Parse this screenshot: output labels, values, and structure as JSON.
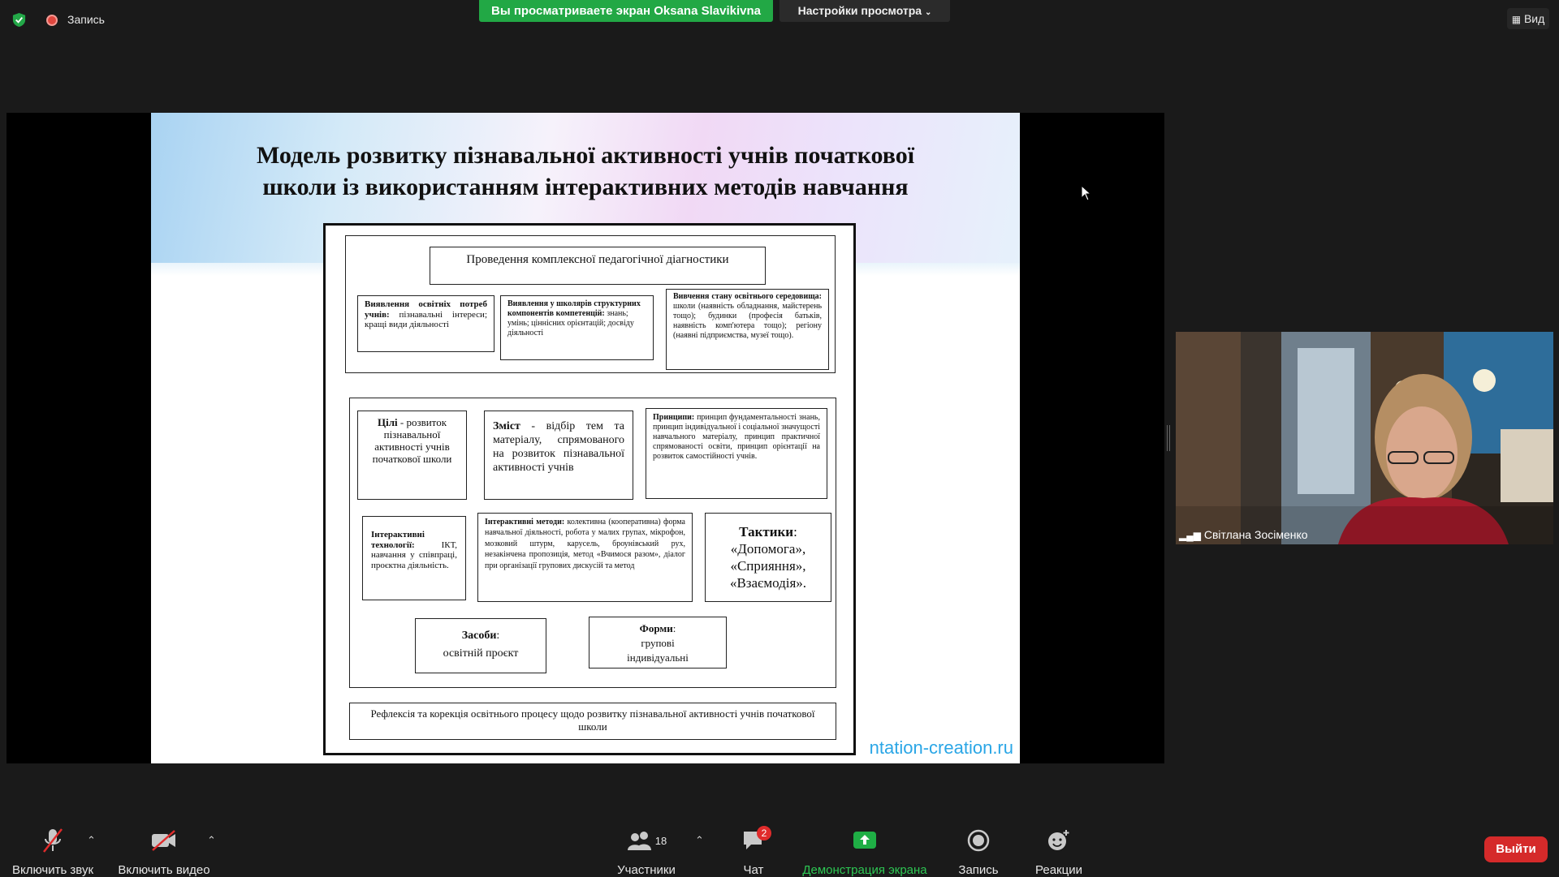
{
  "topbar": {
    "recording_label": "Запись",
    "viewing_banner": "Вы просматриваете экран Oksana Slavikivna",
    "view_settings": "Настройки просмотра",
    "view_button": "Вид"
  },
  "slide": {
    "title_line1": "Модель розвитку пізнавальної активності учнів початкової",
    "title_line2": "школи із використанням інтерактивних методів навчання",
    "site_label": "ntation-creation.ru",
    "diagram": {
      "top_title": "Проведення комплексної педагогічної діагностики",
      "needs_bold": "Виявлення освітніх потреб учнів:",
      "needs_text": "пізнавальні інтереси; кращі види діяльності",
      "components_bold": "Виявлення у школярів структурних компонентів компетенцій:",
      "components_text": "знань; умінь; ціннісних орієнтацій; досвіду діяльності",
      "environment_bold": "Вивчення стану освітнього середовища:",
      "environment_text": "школи (наявність обладнання, майстерень тощо); будинки (професія батьків, наявність комп'ютера тощо); регіону (наявні підприємства, музеї тощо).",
      "goals_bold": "Цілі",
      "goals_text": " - розвиток пізнавальної активності учнів початкової школи",
      "content_bold": "Зміст",
      "content_text": " - відбір тем та матеріалу, спрямованого на розвиток пізнавальної активності учнів",
      "principles_bold": "Принципи:",
      "principles_text": " принцип фундаментальності знань, принцип індивідуальної і соціальної значущості навчального матеріалу, принцип практичної спрямованості освіти, принцип орієнтації на розвиток самостійності учнів.",
      "tech_bold": "Інтерактивні технології:",
      "tech_text": "ІКТ, навчання у співпраці, проєктна діяльність.",
      "methods_bold": "Інтерактивні методи:",
      "methods_text": "колективна (кооперативна) форма навчальної діяльності, робота у малих групах, мікрофон, мозковий штурм, карусель, броунівський рух, незакінчена пропозиція, метод «Вчимося разом», діалог при організації групових дискусій та метод",
      "tactics_bold": "Тактики",
      "tactics_colon": ":",
      "tactic1": "«Допомога»,",
      "tactic2": "«Сприяння»,",
      "tactic3": "«Взаємодія».",
      "means_bold": "Засоби",
      "means_colon": ":",
      "means_text": "освітній проєкт",
      "forms_bold": "Форми",
      "forms_colon": ":",
      "forms_line1": "групові",
      "forms_line2": "індивідуальні",
      "reflection": "Рефлексія та корекція освітнього процесу щодо розвитку пізнавальної активності учнів початкової школи"
    }
  },
  "participant": {
    "name": "Світлана Зосіменко"
  },
  "toolbar": {
    "unmute_label": "Включить звук",
    "video_label": "Включить видео",
    "participants_label": "Участники",
    "participants_count": "18",
    "chat_label": "Чат",
    "chat_badge": "2",
    "share_label": "Демонстрация экрана",
    "record_label": "Запись",
    "reactions_label": "Реакции",
    "exit_label": "Выйти"
  },
  "colors": {
    "share_green": "#22a845",
    "exit_red": "#d52a2a",
    "link_blue": "#2aa6e6"
  }
}
